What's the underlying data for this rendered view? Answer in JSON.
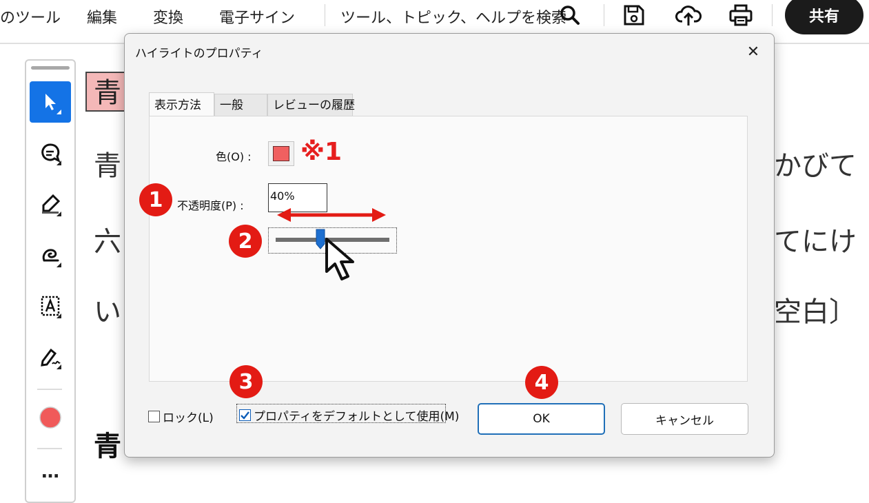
{
  "menubar": {
    "tools_label": "のツール",
    "edit_label": "編集",
    "convert_label": "変換",
    "esign_label": "電子サイン",
    "search_label": "ツール、トピック、ヘルプを検索",
    "share_label": "共有",
    "icons": [
      "search-icon",
      "save-icon",
      "cloud-upload-icon",
      "print-icon"
    ]
  },
  "toolbar": {
    "tools": [
      "select-tool",
      "comment-tool",
      "highlight-tool",
      "draw-tool",
      "text-box-tool",
      "sign-tool"
    ],
    "color_dot": "#f05a5a",
    "more_label": "…"
  },
  "document": {
    "heading_char": "青",
    "line1_left": "青",
    "line1_right": "かびて",
    "line2_left": "六",
    "line2_right": "てにけ",
    "line3_left": "い",
    "line3_right": "空白〕",
    "bottom_line": "青"
  },
  "dialog": {
    "title": "ハイライトのプロパティ",
    "close_label": "✕",
    "tabs": [
      {
        "label": "表示方法",
        "active": true
      },
      {
        "label": "一般",
        "active": false
      },
      {
        "label": "レビューの履歴",
        "active": false
      }
    ],
    "color_label": "色(O) :",
    "color_value": "#f06060",
    "note_mark": "※1",
    "opacity_label": "不透明度(P) :",
    "opacity_value": "40%",
    "opacity_level": 0.4,
    "lock_label": "ロック(L)",
    "lock_checked": false,
    "default_label": "プロパティをデフォルトとして使用(M)",
    "default_checked": true,
    "ok_label": "OK",
    "cancel_label": "キャンセル"
  },
  "annotations": {
    "badge1": "1",
    "badge2": "2",
    "badge3": "3",
    "badge4": "4",
    "badge_color": "#e31b14",
    "arrow_color": "#e31b14"
  }
}
